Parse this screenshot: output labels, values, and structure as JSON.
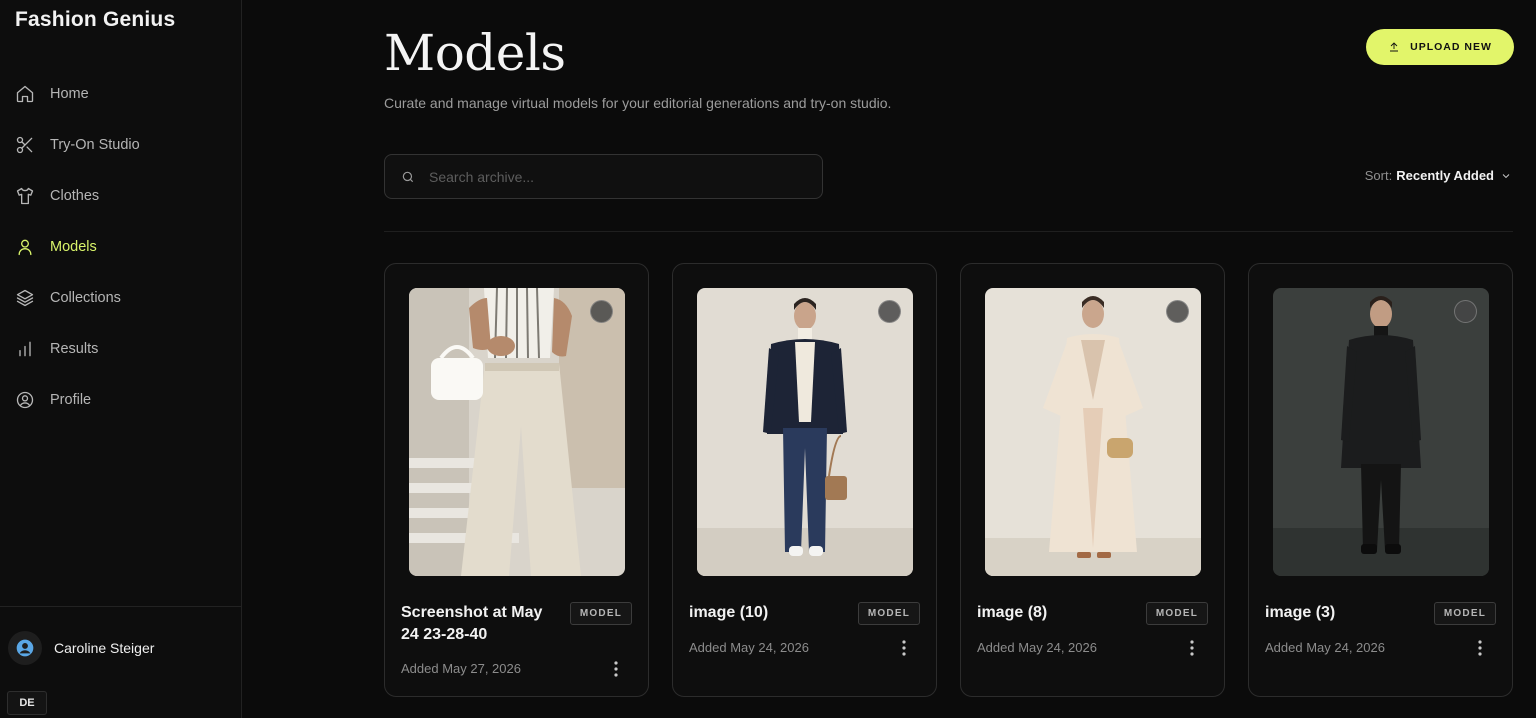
{
  "app": {
    "brand": "Fashion Genius"
  },
  "sidebar": {
    "items": [
      {
        "label": "Home",
        "icon": "home-icon",
        "active": false
      },
      {
        "label": "Try-On Studio",
        "icon": "scissors-icon",
        "active": false
      },
      {
        "label": "Clothes",
        "icon": "shirt-icon",
        "active": false
      },
      {
        "label": "Models",
        "icon": "user-icon",
        "active": true
      },
      {
        "label": "Collections",
        "icon": "layers-icon",
        "active": false
      },
      {
        "label": "Results",
        "icon": "bar-chart-icon",
        "active": false
      },
      {
        "label": "Profile",
        "icon": "user-circle-icon",
        "active": false
      }
    ],
    "user": {
      "name": "Caroline Steiger"
    },
    "language": "DE"
  },
  "header": {
    "title": "Models",
    "subtitle": "Curate and manage virtual models for your editorial generations and try-on studio.",
    "upload_label": "UPLOAD NEW"
  },
  "search": {
    "placeholder": "Search archive..."
  },
  "sort": {
    "label": "Sort:",
    "value": "Recently Added"
  },
  "models": [
    {
      "name": "Screenshot at May 24 23-28-40",
      "badge": "MODEL",
      "added": "Added May 27, 2026"
    },
    {
      "name": "image (10)",
      "badge": "MODEL",
      "added": "Added May 24, 2026"
    },
    {
      "name": "image (8)",
      "badge": "MODEL",
      "added": "Added May 24, 2026"
    },
    {
      "name": "image (3)",
      "badge": "MODEL",
      "added": "Added May 24, 2026"
    }
  ],
  "colors": {
    "accent": "#e2f56a",
    "active_nav": "#d9f46a",
    "background": "#0b0b0b"
  }
}
